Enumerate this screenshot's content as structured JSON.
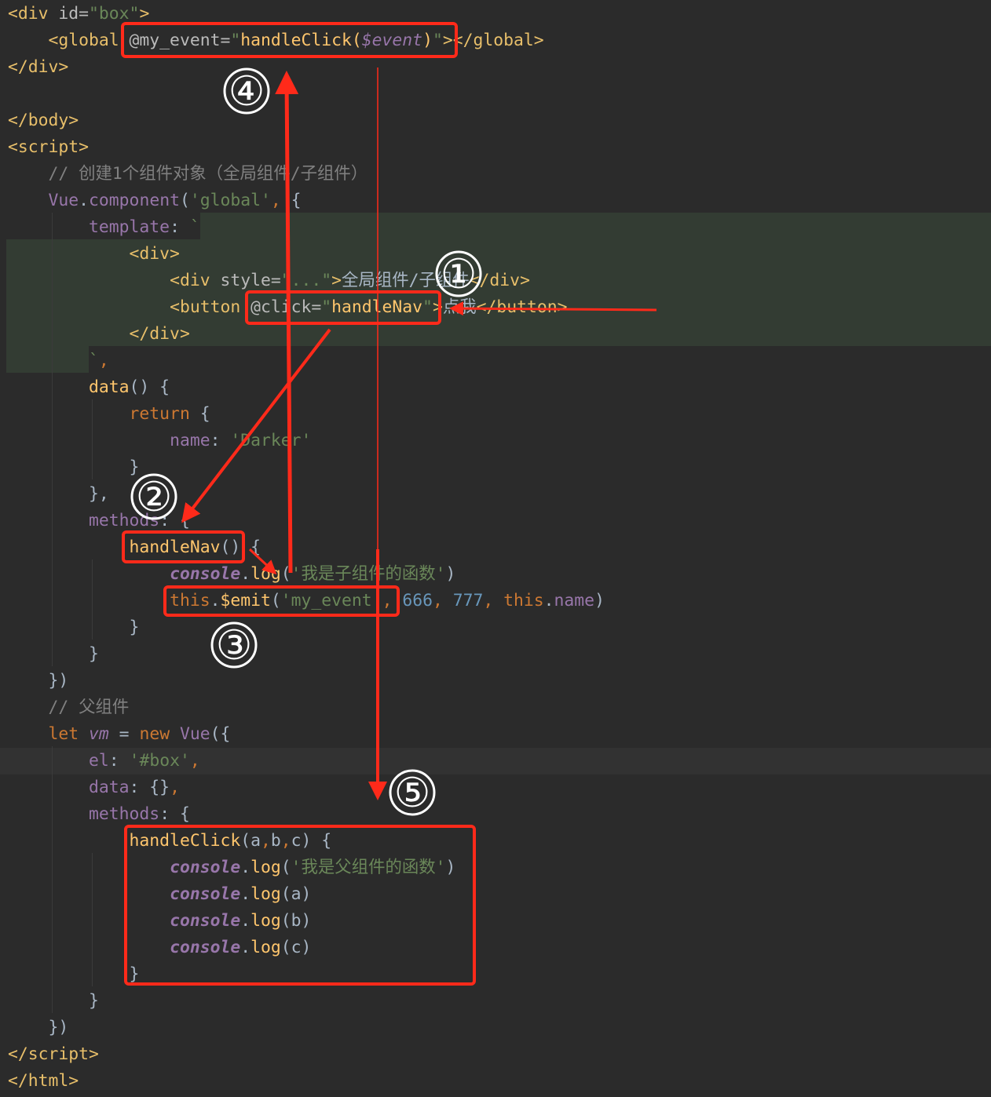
{
  "theme": {
    "background": "#2b2b2b",
    "annotation_color": "#ff2a1a",
    "badge_color": "#ffffff"
  },
  "code": {
    "lines": [
      [
        [
          "<div ",
          "t"
        ],
        [
          "id=",
          "a"
        ],
        [
          "\"box\"",
          "s"
        ],
        [
          ">",
          "t"
        ]
      ],
      [
        [
          "    ",
          "d"
        ],
        [
          "<global ",
          "t"
        ],
        [
          "@my_event=",
          "a"
        ],
        [
          "\"",
          "s"
        ],
        [
          "handleClick(",
          "f"
        ],
        [
          "$event",
          "v"
        ],
        [
          ")",
          "f"
        ],
        [
          "\"",
          "s"
        ],
        [
          "></global>",
          "t"
        ]
      ],
      [
        [
          "</div>",
          "t"
        ]
      ],
      [],
      [
        [
          "</body>",
          "t"
        ]
      ],
      [
        [
          "<script>",
          "t"
        ]
      ],
      [
        [
          "    // 创建1个组件对象（全局组件/子组件）",
          "c"
        ]
      ],
      [
        [
          "    ",
          "d"
        ],
        [
          "Vue",
          "p"
        ],
        [
          ".",
          "d"
        ],
        [
          "component",
          "p"
        ],
        [
          "(",
          "d"
        ],
        [
          "'global'",
          "s"
        ],
        [
          ", ",
          "k"
        ],
        [
          "{",
          "d"
        ]
      ],
      [
        [
          "        ",
          "d"
        ],
        [
          "template",
          "p"
        ],
        [
          ": ",
          "d"
        ],
        [
          "`",
          "s"
        ]
      ],
      [
        [
          "            ",
          "d"
        ],
        [
          "<div>",
          "t"
        ]
      ],
      [
        [
          "                ",
          "d"
        ],
        [
          "<div ",
          "t"
        ],
        [
          "style=",
          "a"
        ],
        [
          "\"...\"",
          "s"
        ],
        [
          ">",
          "t"
        ],
        [
          "全局组件/子组件",
          "d"
        ],
        [
          "</div>",
          "t"
        ]
      ],
      [
        [
          "                ",
          "d"
        ],
        [
          "<button ",
          "t"
        ],
        [
          "@click=",
          "a"
        ],
        [
          "\"",
          "s"
        ],
        [
          "handleNav",
          "f"
        ],
        [
          "\"",
          "s"
        ],
        [
          ">",
          "t"
        ],
        [
          "点我",
          "d"
        ],
        [
          "</button>",
          "t"
        ]
      ],
      [
        [
          "            ",
          "d"
        ],
        [
          "</div>",
          "t"
        ]
      ],
      [
        [
          "        ",
          "d"
        ],
        [
          "`",
          "s"
        ],
        [
          ",",
          "k"
        ]
      ],
      [
        [
          "        ",
          "d"
        ],
        [
          "data",
          "f"
        ],
        [
          "() {",
          "d"
        ]
      ],
      [
        [
          "            ",
          "d"
        ],
        [
          "return",
          "k"
        ],
        [
          " {",
          "d"
        ]
      ],
      [
        [
          "                ",
          "d"
        ],
        [
          "name",
          "p"
        ],
        [
          ": ",
          "d"
        ],
        [
          "'Darker'",
          "s"
        ]
      ],
      [
        [
          "            }",
          "d"
        ]
      ],
      [
        [
          "        },",
          "d"
        ]
      ],
      [
        [
          "        ",
          "d"
        ],
        [
          "methods",
          "p"
        ],
        [
          ": {",
          "d"
        ]
      ],
      [
        [
          "            ",
          "d"
        ],
        [
          "handleNav",
          "f"
        ],
        [
          "() {",
          "d"
        ]
      ],
      [
        [
          "                ",
          "d"
        ],
        [
          "console",
          "i"
        ],
        [
          ".",
          "d"
        ],
        [
          "log",
          "f"
        ],
        [
          "(",
          "d"
        ],
        [
          "'我是子组件的函数'",
          "s"
        ],
        [
          ")",
          "d"
        ]
      ],
      [
        [
          "                ",
          "d"
        ],
        [
          "this",
          "k"
        ],
        [
          ".",
          "d"
        ],
        [
          "$emit",
          "f"
        ],
        [
          "(",
          "d"
        ],
        [
          "'my_event'",
          "s"
        ],
        [
          ", ",
          "k"
        ],
        [
          "666",
          "n"
        ],
        [
          ", ",
          "k"
        ],
        [
          "777",
          "n"
        ],
        [
          ", ",
          "k"
        ],
        [
          "this",
          "k"
        ],
        [
          ".",
          "d"
        ],
        [
          "name",
          "p"
        ],
        [
          ")",
          "d"
        ]
      ],
      [
        [
          "            }",
          "d"
        ]
      ],
      [
        [
          "        }",
          "d"
        ]
      ],
      [
        [
          "    })",
          "d"
        ]
      ],
      [
        [
          "    // 父组件",
          "c"
        ]
      ],
      [
        [
          "    ",
          "d"
        ],
        [
          "let ",
          "k"
        ],
        [
          "vm",
          "v"
        ],
        [
          " = ",
          "d"
        ],
        [
          "new ",
          "k"
        ],
        [
          "Vue",
          "p"
        ],
        [
          "({",
          "d"
        ]
      ],
      [
        [
          "        ",
          "d"
        ],
        [
          "el",
          "p"
        ],
        [
          ": ",
          "d"
        ],
        [
          "'#box'",
          "s"
        ],
        [
          ",",
          "k"
        ]
      ],
      [
        [
          "        ",
          "d"
        ],
        [
          "data",
          "p"
        ],
        [
          ": {}",
          "d"
        ],
        [
          ",",
          "k"
        ]
      ],
      [
        [
          "        ",
          "d"
        ],
        [
          "methods",
          "p"
        ],
        [
          ": {",
          "d"
        ]
      ],
      [
        [
          "            ",
          "d"
        ],
        [
          "handleClick",
          "f"
        ],
        [
          "(a",
          "d"
        ],
        [
          ",",
          "k"
        ],
        [
          "b",
          "d"
        ],
        [
          ",",
          "k"
        ],
        [
          "c) {",
          "d"
        ]
      ],
      [
        [
          "                ",
          "d"
        ],
        [
          "console",
          "i"
        ],
        [
          ".",
          "d"
        ],
        [
          "log",
          "f"
        ],
        [
          "(",
          "d"
        ],
        [
          "'我是父组件的函数'",
          "s"
        ],
        [
          ")",
          "d"
        ]
      ],
      [
        [
          "                ",
          "d"
        ],
        [
          "console",
          "i"
        ],
        [
          ".",
          "d"
        ],
        [
          "log",
          "f"
        ],
        [
          "(a)",
          "d"
        ]
      ],
      [
        [
          "                ",
          "d"
        ],
        [
          "console",
          "i"
        ],
        [
          ".",
          "d"
        ],
        [
          "log",
          "f"
        ],
        [
          "(b)",
          "d"
        ]
      ],
      [
        [
          "                ",
          "d"
        ],
        [
          "console",
          "i"
        ],
        [
          ".",
          "d"
        ],
        [
          "log",
          "f"
        ],
        [
          "(c)",
          "d"
        ]
      ],
      [
        [
          "            }",
          "d"
        ]
      ],
      [
        [
          "        }",
          "d"
        ]
      ],
      [
        [
          "    })",
          "d"
        ]
      ],
      [
        [
          "</script>",
          "t"
        ]
      ],
      [
        [
          "</html>",
          "t"
        ]
      ]
    ]
  },
  "annotations": {
    "steps": [
      "④",
      "①",
      "②",
      "③",
      "⑤"
    ]
  }
}
